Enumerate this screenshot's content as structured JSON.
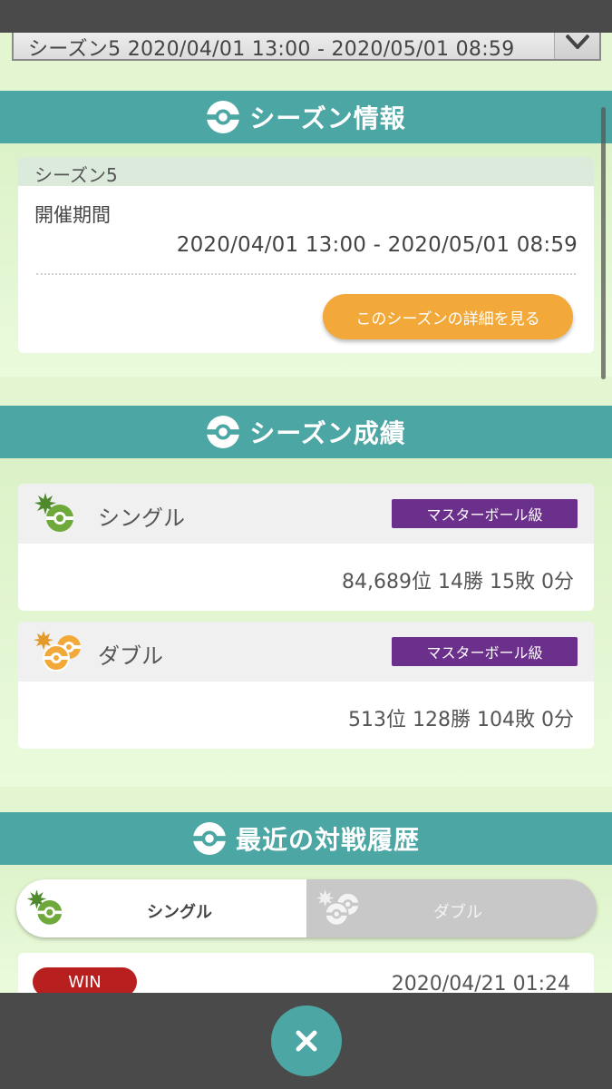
{
  "season_select": {
    "value": "シーズン5 2020/04/01 13:00 - 2020/05/01 08:59"
  },
  "season_info": {
    "header": "シーズン情報",
    "card_title": "シーズン5",
    "period_label": "開催期間",
    "period_value": "2020/04/01 13:00 - 2020/05/01 08:59",
    "detail_button": "このシーズンの詳細を見る"
  },
  "season_record": {
    "header": "シーズン成績",
    "single": {
      "name": "シングル",
      "rank": "マスターボール級",
      "stats": "84,689位 14勝 15敗 0分"
    },
    "double": {
      "name": "ダブル",
      "rank": "マスターボール級",
      "stats": "513位 128勝 104敗 0分"
    }
  },
  "history": {
    "header": "最近の対戦履歴",
    "tabs": {
      "single": "シングル",
      "double": "ダブル"
    },
    "items": [
      {
        "result": "WIN",
        "date": "2020/04/21 01:24"
      }
    ]
  },
  "colors": {
    "teal": "#4ca6a4",
    "orange": "#f3a93a",
    "master_purple": "#6b2f8c",
    "win_red": "#b82020",
    "single_green": "#6fa83b",
    "double_orange": "#f3a93a"
  },
  "icons": [
    "chevron-down-icon",
    "pokeball-icon",
    "single-battle-icon",
    "double-battle-icon",
    "close-icon"
  ]
}
